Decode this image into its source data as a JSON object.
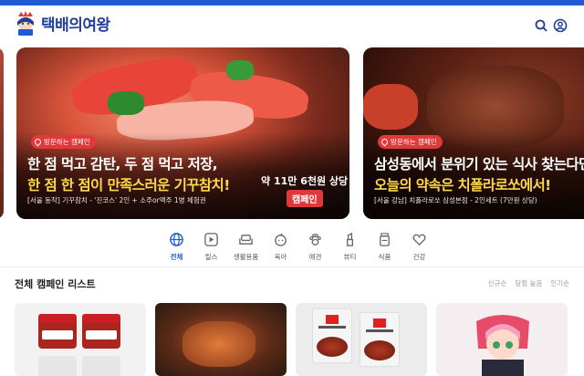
{
  "header": {
    "logo_text": "택배의여왕",
    "search_icon": "search-icon",
    "account_icon": "user-icon"
  },
  "colors": {
    "brand_blue": "#1f5bd6",
    "logo_navy": "#1f3f9a",
    "badge_red": "#e0393b",
    "headline_yellow": "#ffd84a"
  },
  "slides": [
    {
      "tag": "방문하는 캠페인",
      "headline_1": "한 점 먹고 감탄, 두 점 먹고 저장,",
      "headline_2": "한 점 한 점이 만족스러운 기꾸참치!",
      "subtitle": "[서울 동작] 기꾸참치 - '진코스' 2인 + 소주or맥주 1병 체험권",
      "price_line": "약 11만 6천원 상당",
      "price_tag": "캠페인"
    },
    {
      "tag": "방문하는 캠페인",
      "headline_1": "삼성동에서 분위기 있는 식사 찾는다면?",
      "headline_2": "오늘의 약속은 치폴라로쏘에서!",
      "subtitle": "[서울 강남] 치폴라로쏘 삼성본점 - 2인세트 (7만원 상당)"
    }
  ],
  "categories": [
    {
      "label": "전체",
      "icon": "globe-icon",
      "active": true
    },
    {
      "label": "릴스",
      "icon": "play-icon",
      "active": false
    },
    {
      "label": "생활용품",
      "icon": "sofa-icon",
      "active": false
    },
    {
      "label": "육아",
      "icon": "baby-icon",
      "active": false
    },
    {
      "label": "애견",
      "icon": "paw-icon",
      "active": false
    },
    {
      "label": "뷰티",
      "icon": "lipstick-icon",
      "active": false
    },
    {
      "label": "식품",
      "icon": "food-jar-icon",
      "active": false
    },
    {
      "label": "건강",
      "icon": "heart-icon",
      "active": false
    }
  ],
  "list": {
    "title": "전체 캠페인 리스트",
    "sorts": [
      "신규순",
      "당첨 높음",
      "인기순"
    ]
  }
}
